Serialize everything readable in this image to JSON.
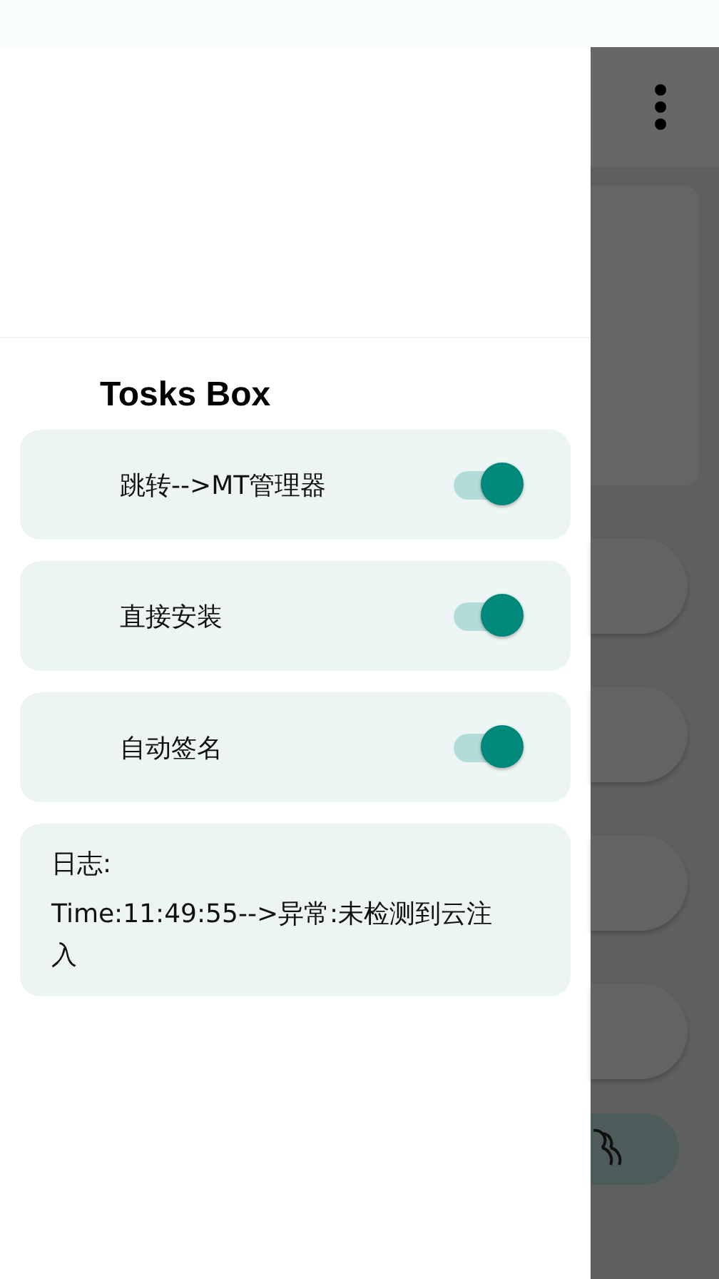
{
  "drawer": {
    "title": "Tosks Box",
    "toggles": [
      {
        "label": "跳转-->MT管理器",
        "on": true
      },
      {
        "label": "直接安装",
        "on": true
      },
      {
        "label": "自动签名",
        "on": true
      }
    ],
    "log": {
      "label": "日志:",
      "message": "Time:11:49:55-->异常:未检测到云注入"
    }
  }
}
